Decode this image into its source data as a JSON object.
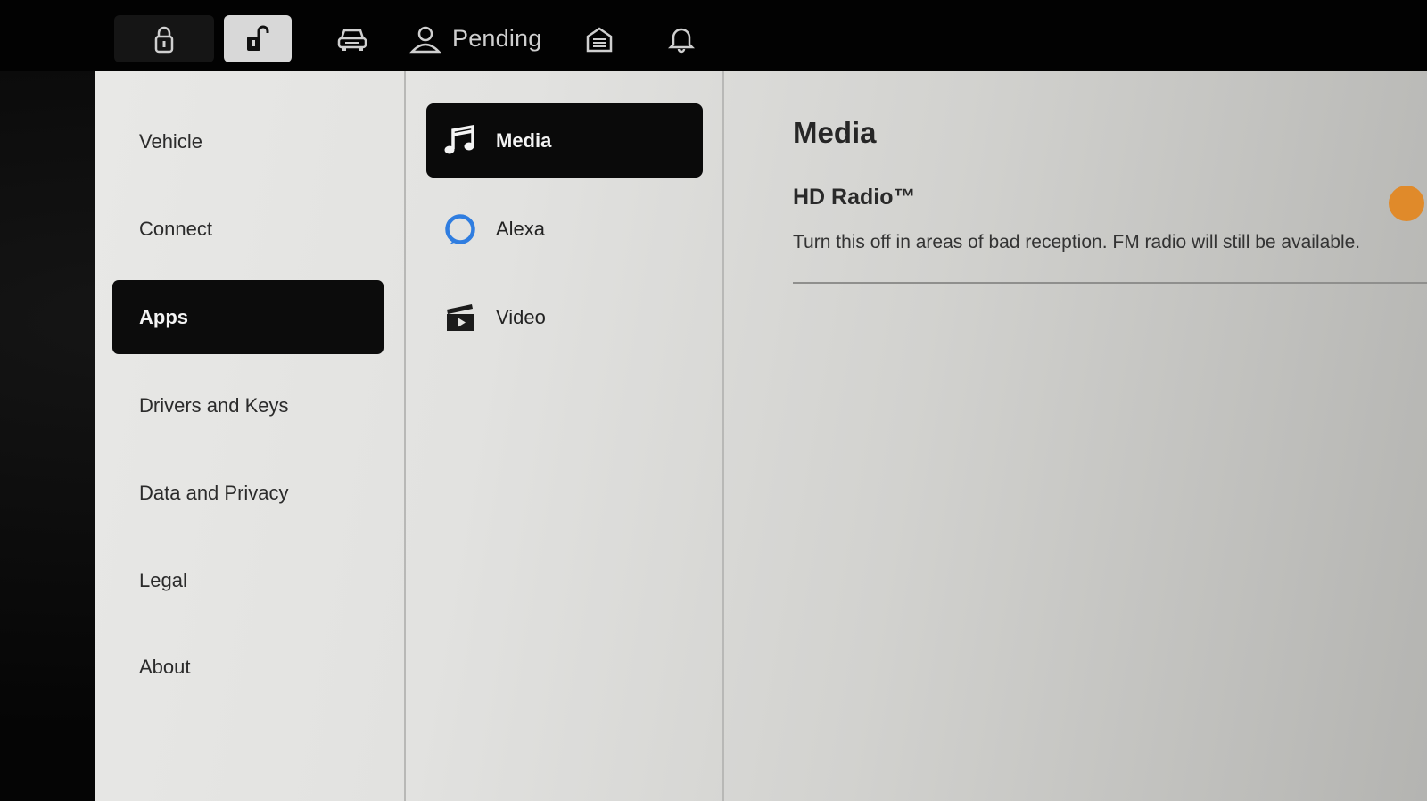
{
  "topbar": {
    "icons": {
      "lock": "lock-icon",
      "unlock": "unlock-icon",
      "car": "car-icon",
      "profile": "profile-icon",
      "garage": "garage-icon",
      "bell": "bell-icon"
    },
    "profile_label": "Pending"
  },
  "sidebar": {
    "items": [
      {
        "label": "Vehicle"
      },
      {
        "label": "Connect"
      },
      {
        "label": "Apps",
        "active": true
      },
      {
        "label": "Drivers and Keys"
      },
      {
        "label": "Data and Privacy"
      },
      {
        "label": "Legal"
      },
      {
        "label": "About"
      }
    ]
  },
  "submenu": {
    "items": [
      {
        "label": "Media",
        "icon": "music-note-icon",
        "active": true
      },
      {
        "label": "Alexa",
        "icon": "alexa-icon"
      },
      {
        "label": "Video",
        "icon": "clapperboard-icon"
      }
    ]
  },
  "content": {
    "title": "Media",
    "settings": [
      {
        "title": "HD Radio™",
        "description": "Turn this off in areas of bad reception. FM radio will still be available.",
        "toggle_on": true
      }
    ]
  },
  "colors": {
    "accent_toggle": "#e08a2a",
    "alexa_blue": "#2f7de0",
    "active_bg": "#0c0c0c"
  }
}
